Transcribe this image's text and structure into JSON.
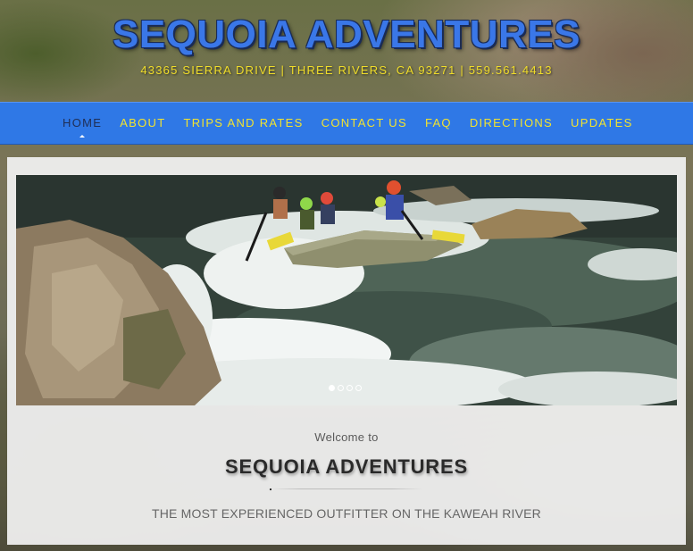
{
  "header": {
    "site_title": "SEQUOIA ADVENTURES",
    "address": "43365 SIERRA DRIVE | THREE RIVERS, CA 93271 | 559.561.4413"
  },
  "nav": {
    "items": [
      {
        "label": "HOME",
        "active": true
      },
      {
        "label": "ABOUT"
      },
      {
        "label": "TRIPS AND RATES"
      },
      {
        "label": "CONTACT US"
      },
      {
        "label": "FAQ"
      },
      {
        "label": "DIRECTIONS"
      },
      {
        "label": "UPDATES"
      }
    ]
  },
  "slider": {
    "image_subject": "rafters-on-whitewater-rapids",
    "slide_count": 4,
    "active_slide": 1
  },
  "welcome": {
    "pre": "Welcome to",
    "title": "SEQUOIA ADVENTURES",
    "tagline": "THE MOST EXPERIENCED OUTFITTER ON THE KAWEAH RIVER"
  },
  "colors": {
    "nav_bg": "#2f78e6",
    "nav_text": "#f2e32f",
    "nav_active_text": "#1f2e55",
    "title_blue": "#3a77e8",
    "address_yellow": "#f0dd2a"
  }
}
